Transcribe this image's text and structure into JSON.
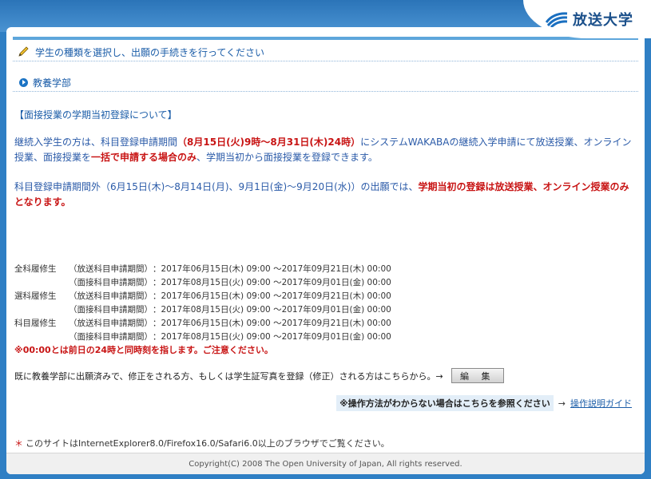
{
  "header": {
    "logo_text": "放送大学",
    "brand_color": "#1a4f8a"
  },
  "section": {
    "heading": "学生の種類を選択し、出願の手続きを行ってください",
    "subheading": "教養学部"
  },
  "notice": {
    "title": "【面接授業の学期当初登録について】",
    "p1_a": "継続入学生の方は、科目登録申請期間",
    "p1_red": "（8月15日(火)9時～8月31日(木)24時）",
    "p1_b": "にシステムWAKABAの継続入学申請にて放送授業、オンライン授業、面接授業を",
    "p1_bold": "一括で申請する場合のみ",
    "p1_c": "、学期当初から面接授業を登録できます。",
    "p2_a": "科目登録申請期間外（6月15日(木)～8月14日(月)、9月1日(金)～9月20日(水)）の出願では、",
    "p2_red": "学期当初の登録は放送授業、オンライン授業のみとなります。"
  },
  "periods": [
    {
      "label": "全科履修生",
      "type": "（放送科目申請期間）",
      "range": "：2017年06月15日(木) 09:00 ～2017年09月21日(木) 00:00"
    },
    {
      "label": "",
      "type": "（面接科目申請期間）",
      "range": "：2017年08月15日(火) 09:00 ～2017年09月01日(金) 00:00"
    },
    {
      "label": "選科履修生",
      "type": "（放送科目申請期間）",
      "range": "：2017年06月15日(木) 09:00 ～2017年09月21日(木) 00:00"
    },
    {
      "label": "",
      "type": "（面接科目申請期間）",
      "range": "：2017年08月15日(火) 09:00 ～2017年09月01日(金) 00:00"
    },
    {
      "label": "科目履修生",
      "type": "（放送科目申請期間）",
      "range": "：2017年06月15日(木) 09:00 ～2017年09月21日(木) 00:00"
    },
    {
      "label": "",
      "type": "（面接科目申請期間）",
      "range": "：2017年08月15日(火) 09:00 ～2017年09月01日(金) 00:00"
    }
  ],
  "warning": "※00:00とは前日の24時と同時刻を指します。ご注意ください。",
  "edit": {
    "text": "既に教養学部に出願済みで、修正をされる方、もしくは学生証写真を登録（修正）される方はこちらから。→",
    "button_label": "編 集"
  },
  "guide": {
    "note": "※操作方法がわからない場合はこちらを参照ください",
    "arrow": "→",
    "link": "操作説明ガイド"
  },
  "browser_note": {
    "star": "＊",
    "text": "このサイトはInternetExplorer8.0/Firefox16.0/Safari6.0以上のブラウザでご覧ください。"
  },
  "footer": "Copyright(C) 2008 The Open University of Japan, All rights reserved."
}
